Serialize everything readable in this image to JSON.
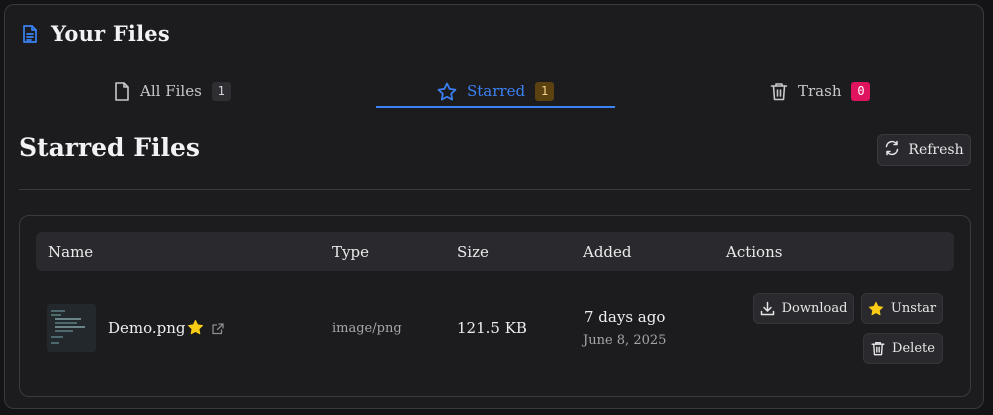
{
  "app": {
    "title": "Your Files"
  },
  "tabs": [
    {
      "label": "All Files",
      "count": "1"
    },
    {
      "label": "Starred",
      "count": "1"
    },
    {
      "label": "Trash",
      "count": "0"
    }
  ],
  "section": {
    "title": "Starred Files",
    "refresh_label": "Refresh"
  },
  "table": {
    "headers": [
      "Name",
      "Type",
      "Size",
      "Added",
      "Actions"
    ],
    "rows": [
      {
        "name": "Demo.png",
        "type": "image/png",
        "size": "121.5 KB",
        "added_relative": "7 days ago",
        "added_date": "June 8, 2025",
        "actions": {
          "download": "Download",
          "unstar": "Unstar",
          "delete": "Delete"
        }
      }
    ]
  },
  "colors": {
    "accent": "#3b82f6",
    "star": "#facc15",
    "trash_badge": "#e0135f",
    "starred_badge": "#5c4210"
  },
  "icons": [
    "file-text-icon",
    "file-icon",
    "star-outline-icon",
    "trash-icon",
    "refresh-icon",
    "star-filled-icon",
    "external-link-icon",
    "download-icon"
  ]
}
